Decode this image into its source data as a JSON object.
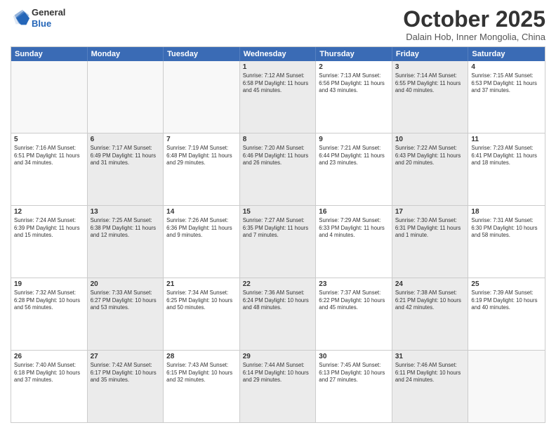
{
  "header": {
    "logo_general": "General",
    "logo_blue": "Blue",
    "month_title": "October 2025",
    "location": "Dalain Hob, Inner Mongolia, China"
  },
  "day_headers": [
    "Sunday",
    "Monday",
    "Tuesday",
    "Wednesday",
    "Thursday",
    "Friday",
    "Saturday"
  ],
  "weeks": [
    [
      {
        "num": "",
        "info": "",
        "empty": true
      },
      {
        "num": "",
        "info": "",
        "empty": true
      },
      {
        "num": "",
        "info": "",
        "empty": true
      },
      {
        "num": "1",
        "info": "Sunrise: 7:12 AM\nSunset: 6:58 PM\nDaylight: 11 hours and 45 minutes.",
        "shaded": true
      },
      {
        "num": "2",
        "info": "Sunrise: 7:13 AM\nSunset: 6:56 PM\nDaylight: 11 hours and 43 minutes.",
        "shaded": false
      },
      {
        "num": "3",
        "info": "Sunrise: 7:14 AM\nSunset: 6:55 PM\nDaylight: 11 hours and 40 minutes.",
        "shaded": true
      },
      {
        "num": "4",
        "info": "Sunrise: 7:15 AM\nSunset: 6:53 PM\nDaylight: 11 hours and 37 minutes.",
        "shaded": false
      }
    ],
    [
      {
        "num": "5",
        "info": "Sunrise: 7:16 AM\nSunset: 6:51 PM\nDaylight: 11 hours and 34 minutes.",
        "shaded": false
      },
      {
        "num": "6",
        "info": "Sunrise: 7:17 AM\nSunset: 6:49 PM\nDaylight: 11 hours and 31 minutes.",
        "shaded": true
      },
      {
        "num": "7",
        "info": "Sunrise: 7:19 AM\nSunset: 6:48 PM\nDaylight: 11 hours and 29 minutes.",
        "shaded": false
      },
      {
        "num": "8",
        "info": "Sunrise: 7:20 AM\nSunset: 6:46 PM\nDaylight: 11 hours and 26 minutes.",
        "shaded": true
      },
      {
        "num": "9",
        "info": "Sunrise: 7:21 AM\nSunset: 6:44 PM\nDaylight: 11 hours and 23 minutes.",
        "shaded": false
      },
      {
        "num": "10",
        "info": "Sunrise: 7:22 AM\nSunset: 6:43 PM\nDaylight: 11 hours and 20 minutes.",
        "shaded": true
      },
      {
        "num": "11",
        "info": "Sunrise: 7:23 AM\nSunset: 6:41 PM\nDaylight: 11 hours and 18 minutes.",
        "shaded": false
      }
    ],
    [
      {
        "num": "12",
        "info": "Sunrise: 7:24 AM\nSunset: 6:39 PM\nDaylight: 11 hours and 15 minutes.",
        "shaded": false
      },
      {
        "num": "13",
        "info": "Sunrise: 7:25 AM\nSunset: 6:38 PM\nDaylight: 11 hours and 12 minutes.",
        "shaded": true
      },
      {
        "num": "14",
        "info": "Sunrise: 7:26 AM\nSunset: 6:36 PM\nDaylight: 11 hours and 9 minutes.",
        "shaded": false
      },
      {
        "num": "15",
        "info": "Sunrise: 7:27 AM\nSunset: 6:35 PM\nDaylight: 11 hours and 7 minutes.",
        "shaded": true
      },
      {
        "num": "16",
        "info": "Sunrise: 7:29 AM\nSunset: 6:33 PM\nDaylight: 11 hours and 4 minutes.",
        "shaded": false
      },
      {
        "num": "17",
        "info": "Sunrise: 7:30 AM\nSunset: 6:31 PM\nDaylight: 11 hours and 1 minute.",
        "shaded": true
      },
      {
        "num": "18",
        "info": "Sunrise: 7:31 AM\nSunset: 6:30 PM\nDaylight: 10 hours and 58 minutes.",
        "shaded": false
      }
    ],
    [
      {
        "num": "19",
        "info": "Sunrise: 7:32 AM\nSunset: 6:28 PM\nDaylight: 10 hours and 56 minutes.",
        "shaded": false
      },
      {
        "num": "20",
        "info": "Sunrise: 7:33 AM\nSunset: 6:27 PM\nDaylight: 10 hours and 53 minutes.",
        "shaded": true
      },
      {
        "num": "21",
        "info": "Sunrise: 7:34 AM\nSunset: 6:25 PM\nDaylight: 10 hours and 50 minutes.",
        "shaded": false
      },
      {
        "num": "22",
        "info": "Sunrise: 7:36 AM\nSunset: 6:24 PM\nDaylight: 10 hours and 48 minutes.",
        "shaded": true
      },
      {
        "num": "23",
        "info": "Sunrise: 7:37 AM\nSunset: 6:22 PM\nDaylight: 10 hours and 45 minutes.",
        "shaded": false
      },
      {
        "num": "24",
        "info": "Sunrise: 7:38 AM\nSunset: 6:21 PM\nDaylight: 10 hours and 42 minutes.",
        "shaded": true
      },
      {
        "num": "25",
        "info": "Sunrise: 7:39 AM\nSunset: 6:19 PM\nDaylight: 10 hours and 40 minutes.",
        "shaded": false
      }
    ],
    [
      {
        "num": "26",
        "info": "Sunrise: 7:40 AM\nSunset: 6:18 PM\nDaylight: 10 hours and 37 minutes.",
        "shaded": false
      },
      {
        "num": "27",
        "info": "Sunrise: 7:42 AM\nSunset: 6:17 PM\nDaylight: 10 hours and 35 minutes.",
        "shaded": true
      },
      {
        "num": "28",
        "info": "Sunrise: 7:43 AM\nSunset: 6:15 PM\nDaylight: 10 hours and 32 minutes.",
        "shaded": false
      },
      {
        "num": "29",
        "info": "Sunrise: 7:44 AM\nSunset: 6:14 PM\nDaylight: 10 hours and 29 minutes.",
        "shaded": true
      },
      {
        "num": "30",
        "info": "Sunrise: 7:45 AM\nSunset: 6:13 PM\nDaylight: 10 hours and 27 minutes.",
        "shaded": false
      },
      {
        "num": "31",
        "info": "Sunrise: 7:46 AM\nSunset: 6:11 PM\nDaylight: 10 hours and 24 minutes.",
        "shaded": true
      },
      {
        "num": "",
        "info": "",
        "empty": true
      }
    ]
  ]
}
